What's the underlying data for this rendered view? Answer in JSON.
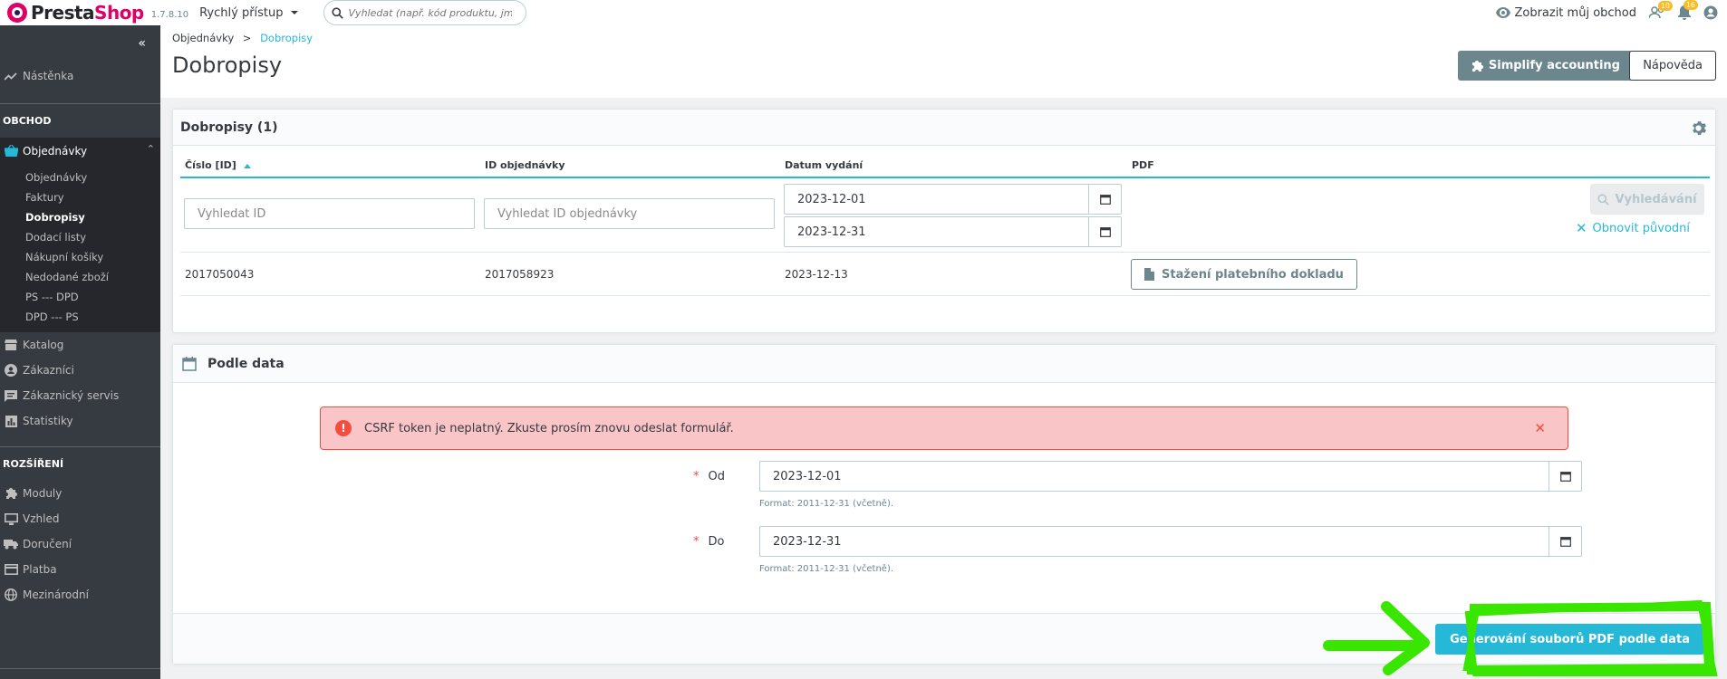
{
  "header": {
    "logo_text_1": "Presta",
    "logo_text_2": "Shop",
    "version": "1.7.8.10",
    "quick_access": "Rychlý přístup",
    "search_placeholder": "Vyhledat (např. kód produktu, jméno z",
    "view_shop": "Zobrazit můj obchod",
    "customers_badge": "10",
    "notifications_badge": "16"
  },
  "sidebar": {
    "dashboard": "Nástěnka",
    "section_shop": "OBCHOD",
    "orders": "Objednávky",
    "orders_sub": [
      "Objednávky",
      "Faktury",
      "Dobropisy",
      "Dodací listy",
      "Nákupní košíky",
      "Nedodané zboží",
      "PS --- DPD",
      "DPD --- PS"
    ],
    "catalog": "Katalog",
    "customers": "Zákazníci",
    "customer_service": "Zákaznický servis",
    "stats": "Statistiky",
    "section_extensions": "ROZŠÍŘENÍ",
    "modules": "Moduly",
    "design": "Vzhled",
    "shipping": "Doručení",
    "payment": "Platba",
    "international": "Mezinárodní"
  },
  "page": {
    "breadcrumb_parent": "Objednávky",
    "breadcrumb_sep": ">",
    "breadcrumb_current": "Dobropisy",
    "title": "Dobropisy",
    "simplify_button": "Simplify accounting",
    "help_button": "Nápověda"
  },
  "grid": {
    "title": "Dobropisy (1)",
    "columns": [
      "Číslo [ID]",
      "ID objednávky",
      "Datum vydání",
      "PDF"
    ],
    "filter_id_placeholder": "Vyhledat ID",
    "filter_order_placeholder": "Vyhledat ID objednávky",
    "date_from": "2023-12-01",
    "date_to": "2023-12-31",
    "search_button": "Vyhledávání",
    "reset_link": "Obnovit původní",
    "rows": [
      {
        "number": "2017050043",
        "order_id": "2017058923",
        "date": "2023-12-13",
        "pdf_button": "Stažení platebního dokladu"
      }
    ]
  },
  "by_date": {
    "title": "Podle data",
    "alert": "CSRF token je neplatný. Zkuste prosím znovu odeslat formulář.",
    "from_label": "Od",
    "from_value": "2023-12-01",
    "to_label": "Do",
    "to_value": "2023-12-31",
    "format_help": "Format: 2011-12-31 (včetně).",
    "generate_button": "Generování souborů PDF podle data"
  },
  "colors": {
    "accent": "#25b9d7",
    "sidebar": "#363a41",
    "error": "#f54c3e",
    "annotation": "#39e600"
  }
}
